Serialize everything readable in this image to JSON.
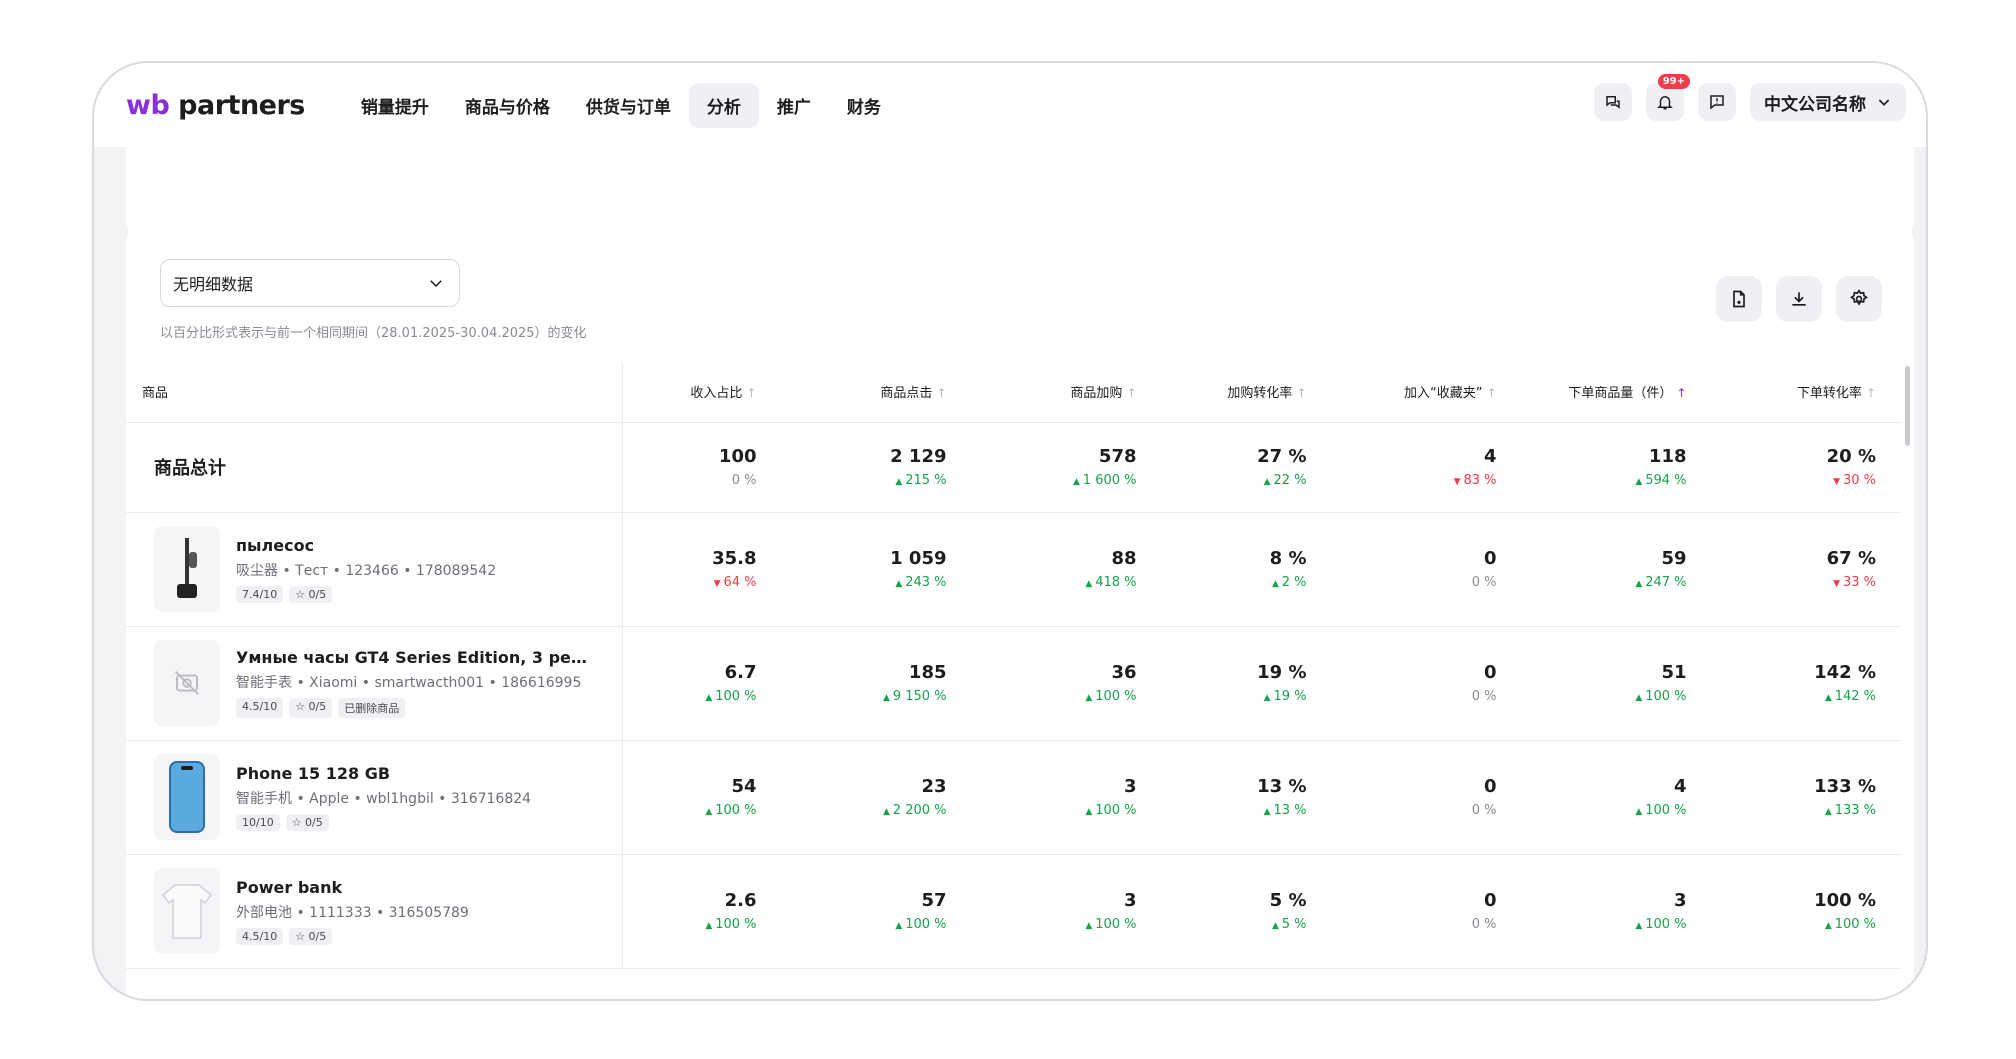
{
  "header": {
    "logo_wb": "wb",
    "logo_partners": " partners",
    "nav": [
      "销量提升",
      "商品与价格",
      "供货与订单",
      "分析",
      "推广",
      "财务"
    ],
    "active_nav": "分析",
    "badge": "99+",
    "company": "中文公司名称"
  },
  "filters": {
    "select_value": "无明细数据",
    "hint": "以百分比形式表示与前一个相同期间（28.01.2025-30.04.2025）的变化"
  },
  "table": {
    "columns": [
      "商品",
      "收入占比",
      "商品点击",
      "商品加购",
      "加购转化率",
      "加入“收藏夹”",
      "下单商品量（件）",
      "下单转化率"
    ],
    "total": {
      "label": "商品总计",
      "cells": [
        {
          "v": "100",
          "c": "0 %",
          "d": "none"
        },
        {
          "v": "2 129",
          "c": "215 %",
          "d": "up"
        },
        {
          "v": "578",
          "c": "1 600 %",
          "d": "up"
        },
        {
          "v": "27 %",
          "c": "22 %",
          "d": "up"
        },
        {
          "v": "4",
          "c": "83 %",
          "d": "down"
        },
        {
          "v": "118",
          "c": "594 %",
          "d": "up"
        },
        {
          "v": "20 %",
          "c": "30 %",
          "d": "down"
        }
      ]
    },
    "rows": [
      {
        "name": "пылесос",
        "meta": "吸尘器 • Тест • 123466 • 178089542",
        "tags": [
          "7.4/10",
          "☆ 0/5"
        ],
        "cells": [
          {
            "v": "35.8",
            "c": "64 %",
            "d": "down"
          },
          {
            "v": "1 059",
            "c": "243 %",
            "d": "up"
          },
          {
            "v": "88",
            "c": "418 %",
            "d": "up"
          },
          {
            "v": "8 %",
            "c": "2 %",
            "d": "up"
          },
          {
            "v": "0",
            "c": "0 %",
            "d": "none"
          },
          {
            "v": "59",
            "c": "247 %",
            "d": "up"
          },
          {
            "v": "67 %",
            "c": "33 %",
            "d": "down"
          }
        ]
      },
      {
        "name": "Умные часы GT4 Series Edition, 3 реме...",
        "meta": "智能手表 • Xiaomi • smartwacth001 • 186616995",
        "tags": [
          "4.5/10",
          "☆ 0/5",
          "已删除商品"
        ],
        "cells": [
          {
            "v": "6.7",
            "c": "100 %",
            "d": "up"
          },
          {
            "v": "185",
            "c": "9 150 %",
            "d": "up"
          },
          {
            "v": "36",
            "c": "100 %",
            "d": "up"
          },
          {
            "v": "19 %",
            "c": "19 %",
            "d": "up"
          },
          {
            "v": "0",
            "c": "0 %",
            "d": "none"
          },
          {
            "v": "51",
            "c": "100 %",
            "d": "up"
          },
          {
            "v": "142 %",
            "c": "142 %",
            "d": "up"
          }
        ]
      },
      {
        "name": "Phone 15 128 GB",
        "meta": "智能手机 • Apple • wbl1hgbil • 316716824",
        "tags": [
          "10/10",
          "☆ 0/5"
        ],
        "cells": [
          {
            "v": "54",
            "c": "100 %",
            "d": "up"
          },
          {
            "v": "23",
            "c": "2 200 %",
            "d": "up"
          },
          {
            "v": "3",
            "c": "100 %",
            "d": "up"
          },
          {
            "v": "13 %",
            "c": "13 %",
            "d": "up"
          },
          {
            "v": "0",
            "c": "0 %",
            "d": "none"
          },
          {
            "v": "4",
            "c": "100 %",
            "d": "up"
          },
          {
            "v": "133 %",
            "c": "133 %",
            "d": "up"
          }
        ]
      },
      {
        "name": "Power bank",
        "meta": "外部电池 • 1111333 • 316505789",
        "tags": [
          "4.5/10",
          "☆ 0/5"
        ],
        "cells": [
          {
            "v": "2.6",
            "c": "100 %",
            "d": "up"
          },
          {
            "v": "57",
            "c": "100 %",
            "d": "up"
          },
          {
            "v": "3",
            "c": "100 %",
            "d": "up"
          },
          {
            "v": "5 %",
            "c": "5 %",
            "d": "up"
          },
          {
            "v": "0",
            "c": "0 %",
            "d": "none"
          },
          {
            "v": "3",
            "c": "100 %",
            "d": "up"
          },
          {
            "v": "100 %",
            "c": "100 %",
            "d": "up"
          }
        ]
      }
    ]
  },
  "icons": {
    "sorted_column": "下单商品量（件）"
  }
}
